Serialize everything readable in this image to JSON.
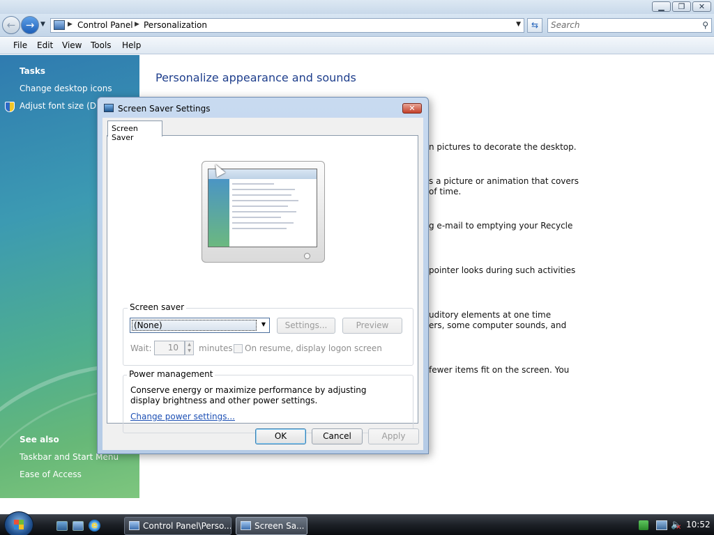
{
  "window": {
    "controls": {
      "minimize": "▁",
      "maximize": "❐",
      "close": "✕"
    }
  },
  "address_bar": {
    "breadcrumbs": [
      "Control Panel",
      "Personalization"
    ],
    "search_placeholder": "Search"
  },
  "menu": [
    "File",
    "Edit",
    "View",
    "Tools",
    "Help"
  ],
  "task_pane": {
    "tasks_title": "Tasks",
    "tasks": [
      "Change desktop icons",
      "Adjust font size (DPI)"
    ],
    "see_also_title": "See also",
    "see_also": [
      "Taskbar and Start Menu",
      "Ease of Access"
    ]
  },
  "content": {
    "title": "Personalize appearance and sounds",
    "fragments": [
      "n pictures to decorate the desktop.",
      "s a picture or animation that covers",
      " of time.",
      "g e-mail to emptying your Recycle",
      " pointer looks during such activities",
      "uditory elements at one time",
      "ers, some computer sounds, and",
      "fewer items fit on the screen. You"
    ]
  },
  "dialog": {
    "title": "Screen Saver Settings",
    "close": "✕",
    "tab": "Screen Saver",
    "screen_saver_label": "Screen saver",
    "screen_saver_selected": "(None)",
    "settings_button": "Settings...",
    "preview_button": "Preview",
    "wait_label": "Wait:",
    "wait_value": "10",
    "minutes_label": "minutes",
    "logon_checkbox_label": "On resume, display logon screen",
    "logon_checked": false,
    "power_label": "Power management",
    "power_description": "Conserve energy or maximize performance by adjusting display brightness and other power settings.",
    "power_link": "Change power settings...",
    "ok_button": "OK",
    "cancel_button": "Cancel",
    "apply_button": "Apply"
  },
  "taskbar": {
    "tasks": [
      "Control Panel\\Perso...",
      "Screen Sa..."
    ],
    "clock": "10:52"
  },
  "colors": {
    "accent": "#1e3e8c",
    "link": "#1c4fb4",
    "taskbar": "#1c2026",
    "task_pane_top": "#2f7bb0",
    "task_pane_bottom": "#7ec67e"
  }
}
